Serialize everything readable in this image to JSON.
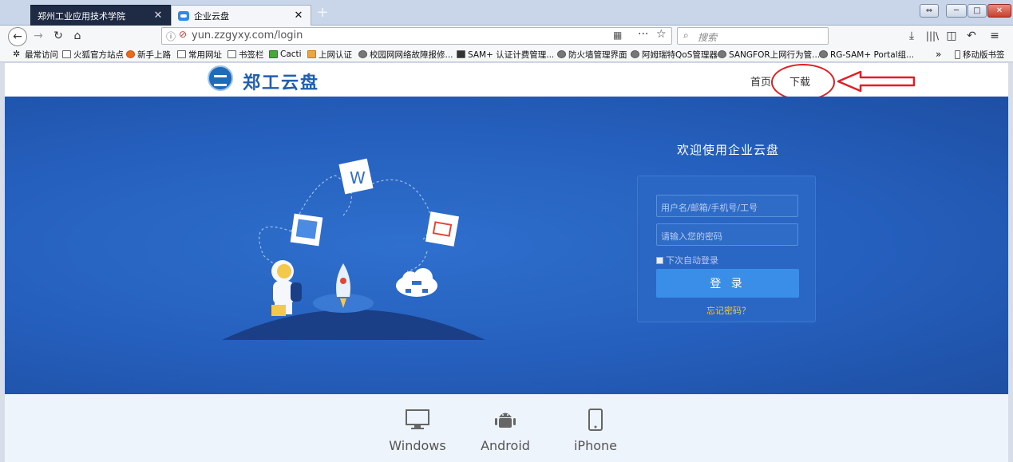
{
  "browser": {
    "tabs": [
      {
        "title": "郑州工业应用技术学院",
        "active": false
      },
      {
        "title": "企业云盘",
        "active": true
      }
    ],
    "url": "yun.zzgyxy.com/login",
    "search_placeholder": "搜索",
    "bookmarks": [
      {
        "label": "最常访问",
        "icon": "gear-icon"
      },
      {
        "label": "火狐官方站点",
        "icon": "folder-icon"
      },
      {
        "label": "新手上路",
        "icon": "firefox-icon"
      },
      {
        "label": "常用网址",
        "icon": "folder-icon"
      },
      {
        "label": "书签栏",
        "icon": "folder-icon"
      },
      {
        "label": "Cacti",
        "icon": "cacti-icon"
      },
      {
        "label": "上网认证",
        "icon": "ep-icon"
      },
      {
        "label": "校园网网络故障报修...",
        "icon": "globe-icon"
      },
      {
        "label": "SAM+ 认证计费管理...",
        "icon": "sam-icon"
      },
      {
        "label": "防火墙管理界面",
        "icon": "globe-icon"
      },
      {
        "label": "阿姆瑞特QoS管理器",
        "icon": "globe-icon"
      },
      {
        "label": "SANGFOR上网行为管...",
        "icon": "globe-icon"
      },
      {
        "label": "RG-SAM+ Portal组...",
        "icon": "globe-icon"
      }
    ],
    "overflow": "»",
    "mobile_bookmarks": "移动版书签"
  },
  "site": {
    "logo_text": "郑工云盘",
    "nav": {
      "home": "首页",
      "download": "下载"
    }
  },
  "hero": {
    "title": "欢迎使用企业云盘",
    "username_placeholder": "用户名/邮箱/手机号/工号",
    "password_placeholder": "请输入您的密码",
    "remember_label": "下次自动登录",
    "login_button": "登 录",
    "forgot_link": "忘记密码？"
  },
  "platforms": [
    {
      "label": "Windows",
      "icon": "monitor-icon"
    },
    {
      "label": "Android",
      "icon": "android-icon"
    },
    {
      "label": "iPhone",
      "icon": "phone-icon"
    }
  ],
  "colors": {
    "hero_blue": "#255fbd",
    "button_blue": "#3b8ee8",
    "annotation_red": "#e11f24",
    "forgot_yellow": "#f2c94c"
  }
}
